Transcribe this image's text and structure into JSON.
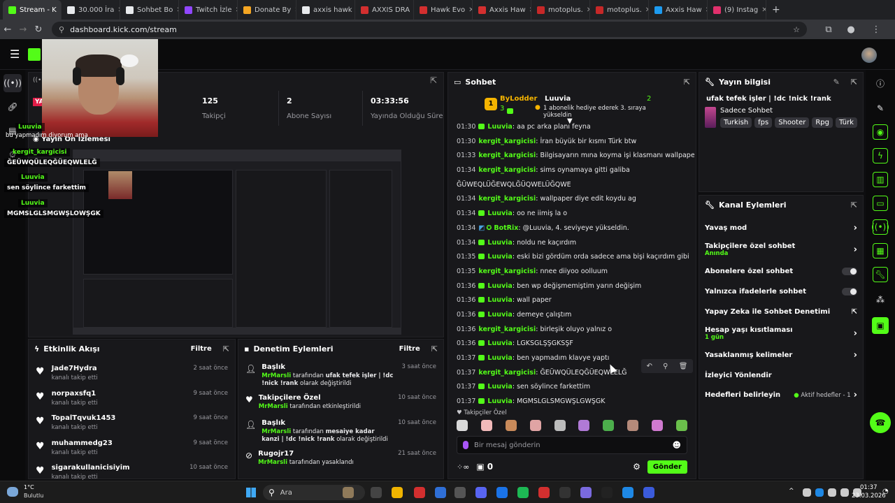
{
  "browser": {
    "tabs": [
      {
        "label": "Stream - K",
        "color": "#53fc18"
      },
      {
        "label": "30.000 İra",
        "color": "#e8eaed"
      },
      {
        "label": "Sohbet Bo",
        "color": "#e8eaed"
      },
      {
        "label": "Twitch İzle",
        "color": "#9147ff"
      },
      {
        "label": "Donate By",
        "color": "#f5a623"
      },
      {
        "label": "axxis hawk",
        "color": "#e8eaed"
      },
      {
        "label": "AXXIS DRA",
        "color": "#d32f2f"
      },
      {
        "label": "Hawk Evo",
        "color": "#d32f2f"
      },
      {
        "label": "Axxis Haw",
        "color": "#d32f2f"
      },
      {
        "label": "motoplus.",
        "color": "#c62828"
      },
      {
        "label": "motoplus.",
        "color": "#c62828"
      },
      {
        "label": "Axxis Haw",
        "color": "#1d9bf0"
      },
      {
        "label": "(9) Instag",
        "color": "#e1306c"
      }
    ],
    "url": "dashboard.kick.com/stream"
  },
  "stream_info": {
    "live_badge": "YA",
    "followers": {
      "value": "125",
      "label": "Takipçi"
    },
    "subs": {
      "value": "2",
      "label": "Abone Sayısı"
    },
    "uptime": {
      "value": "03:33:56",
      "label": "Yayında Olduğu Süre"
    },
    "preview_title": "Yayın Ön İzlemesi"
  },
  "overlay_chat": [
    {
      "text": "bu yapmadım diyorum ama"
    },
    {
      "user": "Luuvia",
      "text": ""
    },
    {
      "user": "kergit_kargicisi",
      "text": "ĞEÜWQÜLEQĞÜEQWLELĞ"
    },
    {
      "user": "Luuvia",
      "text": "sen söylince farkettim"
    },
    {
      "user": "Luuvia",
      "text": "MGMSLGLSMGWŞLOWŞGK"
    }
  ],
  "activity": {
    "title": "Etkinlik Akışı",
    "filter": "Filtre",
    "items": [
      {
        "name": "Jade7Hydra",
        "desc": "kanalı takip etti",
        "time": "2 saat önce"
      },
      {
        "name": "norpaxsfq1",
        "desc": "kanalı takip etti",
        "time": "9 saat önce"
      },
      {
        "name": "TopalTqvuk1453",
        "desc": "kanalı takip etti",
        "time": "9 saat önce"
      },
      {
        "name": "muhammedg23",
        "desc": "kanalı takip etti",
        "time": "9 saat önce"
      },
      {
        "name": "sigarakullanicisiyim",
        "desc": "kanalı takip etti",
        "time": "10 saat önce"
      }
    ]
  },
  "moderation": {
    "title": "Denetim Eylemleri",
    "filter": "Filtre",
    "items": [
      {
        "title": "Başlık",
        "actor": "MrMarsli",
        "desc1": " tarafından ",
        "bold": "ufak tefek işler | !dc !nick !rank",
        "desc2": " olarak değiştirildi",
        "time": "3 saat önce"
      },
      {
        "title": "Takipçilere Özel",
        "actor": "MrMarsli",
        "desc1": " tarafından etkinleştirildi",
        "bold": "",
        "desc2": "",
        "time": "10 saat önce"
      },
      {
        "title": "Başlık",
        "actor": "MrMarsli",
        "desc1": " tarafından ",
        "bold": "mesaiye kadar kanzi | !dc !nick !rank",
        "desc2": " olarak değiştirildi",
        "time": "10 saat önce"
      },
      {
        "title": "Rugojr17",
        "actor": "MrMarsli",
        "desc1": " tarafından yasaklandı",
        "bold": "",
        "desc2": "",
        "time": "21 saat önce"
      }
    ]
  },
  "chat": {
    "title": "Sohbet",
    "top_user": {
      "name": "ByLodder",
      "rank": "1",
      "count": "3",
      "label": "Luuvia",
      "sub_count": "2",
      "gift_text": "1 abonelik hediye ederek 3. sıraya yükseldin"
    },
    "messages": [
      {
        "time": "01:30",
        "user": "Luuvia",
        "text": "aa pc arka planı feyna",
        "sub": true
      },
      {
        "time": "01:30",
        "user": "kergit_kargicisi",
        "text": "İran büyük bir kısmı Türk btw",
        "sub": false
      },
      {
        "time": "01:33",
        "user": "kergit_kargicisi",
        "text": "Bilgisayarın mına koyma işi klasmanı wallpaperlar",
        "sub": false
      },
      {
        "time": "01:34",
        "user": "kergit_kargicisi",
        "text": "sims oynamaya gitti galiba",
        "sub": false
      },
      {
        "time": "",
        "user": "",
        "text": "ĞÜWEQLÜĞEWQLĞÜQWELÜĞQWE",
        "sub": false
      },
      {
        "time": "01:34",
        "user": "kergit_kargicisi",
        "text": "wallpaper diye edit koydu ag",
        "sub": false
      },
      {
        "time": "01:34",
        "user": "Luuvia",
        "text": "oo ne iimiş la o",
        "sub": true
      },
      {
        "time": "01:34",
        "user": "BotRix",
        "text": "@Luuvia, 4. seviyeye yükseldin.",
        "sub": false
      },
      {
        "time": "01:34",
        "user": "Luuvia",
        "text": "noldu ne kaçırdım",
        "sub": true
      },
      {
        "time": "01:35",
        "user": "Luuvia",
        "text": "eski bizi gördüm orda sadece ama bişi kaçırdım gibi",
        "sub": true
      },
      {
        "time": "01:35",
        "user": "kergit_kargicisi",
        "text": "nnee diiyoo oolluum",
        "sub": false
      },
      {
        "time": "01:36",
        "user": "Luuvia",
        "text": "ben wp değişmemiştim yarın değişim",
        "sub": true
      },
      {
        "time": "01:36",
        "user": "Luuvia",
        "text": "wall paper",
        "sub": true
      },
      {
        "time": "01:36",
        "user": "Luuvia",
        "text": "demeye çalıştım",
        "sub": true
      },
      {
        "time": "01:36",
        "user": "kergit_kargicisi",
        "text": "birleşik oluyo yalnız o",
        "sub": false
      },
      {
        "time": "01:36",
        "user": "Luuvia",
        "text": "LGKSGLŞŞGKSŞF",
        "sub": true
      },
      {
        "time": "01:37",
        "user": "Luuvia",
        "text": "ben yapmadım klavye yaptı",
        "sub": true
      },
      {
        "time": "01:37",
        "user": "kergit_kargicisi",
        "text": "ĞEÜWQÜLEQĞÜEQWLELĞ",
        "sub": false
      },
      {
        "time": "01:37",
        "user": "Luuvia",
        "text": "sen söylince farkettim",
        "sub": true
      },
      {
        "time": "01:37",
        "user": "Luuvia",
        "text": "MGMSLGLSMGWŞLGWŞGK",
        "sub": true
      }
    ],
    "followers_only": "Takipçiler Özel",
    "placeholder": "Bir mesaj gönderin",
    "points": "0",
    "send": "Gönder"
  },
  "stream_info_panel": {
    "title": "Yayın bilgisi",
    "stream_title": "ufak tefek işler | !dc !nick !rank",
    "category": "Sadece Sohbet",
    "tags": [
      "Turkish",
      "fps",
      "Shooter",
      "Rpg",
      "Türk"
    ]
  },
  "channel_actions": {
    "title": "Kanal Eylemleri",
    "items": [
      {
        "label": "Yavaş mod",
        "sub": "",
        "control": "arrow"
      },
      {
        "label": "Takipçilere özel sohbet",
        "sub": "Anında",
        "control": "arrow"
      },
      {
        "label": "Abonelere özel sohbet",
        "sub": "",
        "control": "toggle"
      },
      {
        "label": "Yalnızca ifadelerle sohbet",
        "sub": "",
        "control": "toggle"
      },
      {
        "label": "Yapay Zeka ile Sohbet Denetimi",
        "sub": "",
        "control": "external"
      },
      {
        "label": "Hesap yaşı kısıtlaması",
        "sub": "1 gün",
        "control": "arrow"
      },
      {
        "label": "Yasaklanmış kelimeler",
        "sub": "",
        "control": "arrow"
      },
      {
        "label": "İzleyici Yönlendir",
        "sub": "",
        "control": "none"
      },
      {
        "label": "Hedefleri belirleyin",
        "sub": "",
        "control": "goal"
      }
    ],
    "active_goals": "Aktif hedefler - 1"
  },
  "taskbar": {
    "weather_temp": "1°C",
    "weather_desc": "Bulutlu",
    "search": "Ara",
    "time": "01:37",
    "date": "23.03.2026"
  },
  "colors": {
    "accent": "#53fc18",
    "panel": "#18181b",
    "bg": "#0e0e10"
  }
}
